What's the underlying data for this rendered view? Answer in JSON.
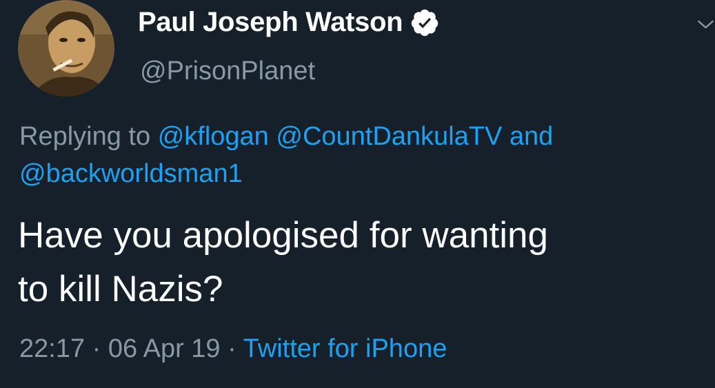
{
  "tweet": {
    "author": {
      "display_name": "Paul Joseph Watson",
      "handle": "@PrisonPlanet",
      "verified": true
    },
    "reply": {
      "prefix": "Replying to",
      "mentions": [
        "@kflogan",
        "@CountDankulaTV",
        "@backworldsman1"
      ],
      "conjunction": "and"
    },
    "text_line1": "Have you apologised for wanting",
    "text_line2": "to kill Nazis?",
    "meta": {
      "time": "22:17",
      "date": "06 Apr 19",
      "separator": "·",
      "source": "Twitter for iPhone"
    }
  },
  "icons": {
    "verified": "verified-badge-icon",
    "menu": "chevron-down-icon"
  },
  "colors": {
    "background": "#15202b",
    "primary_text": "#ffffff",
    "secondary_text": "#8899a6",
    "link": "#1da1f2"
  }
}
